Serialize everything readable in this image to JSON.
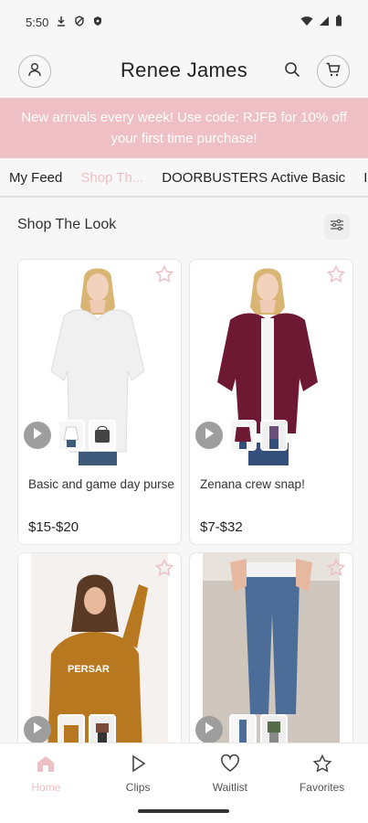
{
  "status": {
    "time": "5:50"
  },
  "header": {
    "brand": "Renee James"
  },
  "banner": {
    "text": "New arrivals every week! Use code: RJFB for 10% off your first time purchase!"
  },
  "tabs": [
    {
      "label": "My Feed"
    },
    {
      "label": "Shop Th..."
    },
    {
      "label": "DOORBUSTERS Active Basic"
    },
    {
      "label": "I"
    }
  ],
  "section": {
    "title": "Shop The Look"
  },
  "cards": [
    {
      "title": "Basic and game day purse",
      "price": "$15-$20"
    },
    {
      "title": "Zenana crew snap!",
      "price": "$7-$32"
    },
    {
      "title": "",
      "price": ""
    },
    {
      "title": "",
      "price": ""
    }
  ],
  "nav": [
    {
      "label": "Home",
      "icon": "home-icon"
    },
    {
      "label": "Clips",
      "icon": "play-icon"
    },
    {
      "label": "Waitlist",
      "icon": "heart-icon"
    },
    {
      "label": "Favorites",
      "icon": "star-icon"
    }
  ],
  "colors": {
    "accent": "#eebfc4",
    "banner": "#eebfc4"
  }
}
